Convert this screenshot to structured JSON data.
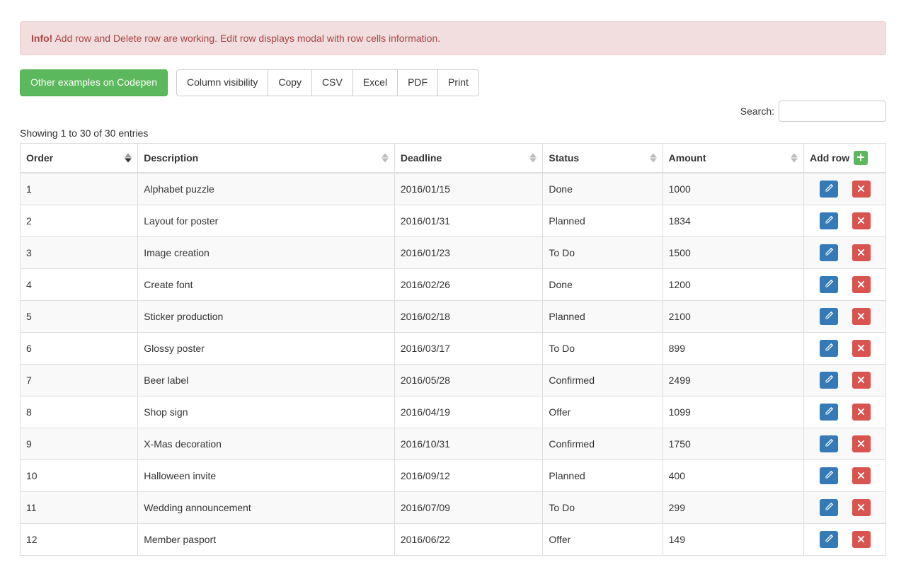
{
  "alert": {
    "tag": "Info!",
    "text": " Add row and Delete row are working. Edit row displays modal with row cells information."
  },
  "toolbar": {
    "codepen": "Other examples on Codepen",
    "buttons": [
      "Column visibility",
      "Copy",
      "CSV",
      "Excel",
      "PDF",
      "Print"
    ]
  },
  "search": {
    "label": "Search:",
    "value": ""
  },
  "info": "Showing 1 to 30 of 30 entries",
  "columns": {
    "order": "Order",
    "description": "Description",
    "deadline": "Deadline",
    "status": "Status",
    "amount": "Amount",
    "addrow": "Add row"
  },
  "rows": [
    {
      "order": "1",
      "description": "Alphabet puzzle",
      "deadline": "2016/01/15",
      "status": "Done",
      "amount": "1000"
    },
    {
      "order": "2",
      "description": "Layout for poster",
      "deadline": "2016/01/31",
      "status": "Planned",
      "amount": "1834"
    },
    {
      "order": "3",
      "description": "Image creation",
      "deadline": "2016/01/23",
      "status": "To Do",
      "amount": "1500"
    },
    {
      "order": "4",
      "description": "Create font",
      "deadline": "2016/02/26",
      "status": "Done",
      "amount": "1200"
    },
    {
      "order": "5",
      "description": "Sticker production",
      "deadline": "2016/02/18",
      "status": "Planned",
      "amount": "2100"
    },
    {
      "order": "6",
      "description": "Glossy poster",
      "deadline": "2016/03/17",
      "status": "To Do",
      "amount": "899"
    },
    {
      "order": "7",
      "description": "Beer label",
      "deadline": "2016/05/28",
      "status": "Confirmed",
      "amount": "2499"
    },
    {
      "order": "8",
      "description": "Shop sign",
      "deadline": "2016/04/19",
      "status": "Offer",
      "amount": "1099"
    },
    {
      "order": "9",
      "description": "X-Mas decoration",
      "deadline": "2016/10/31",
      "status": "Confirmed",
      "amount": "1750"
    },
    {
      "order": "10",
      "description": "Halloween invite",
      "deadline": "2016/09/12",
      "status": "Planned",
      "amount": "400"
    },
    {
      "order": "11",
      "description": "Wedding announcement",
      "deadline": "2016/07/09",
      "status": "To Do",
      "amount": "299"
    },
    {
      "order": "12",
      "description": "Member pasport",
      "deadline": "2016/06/22",
      "status": "Offer",
      "amount": "149"
    }
  ]
}
